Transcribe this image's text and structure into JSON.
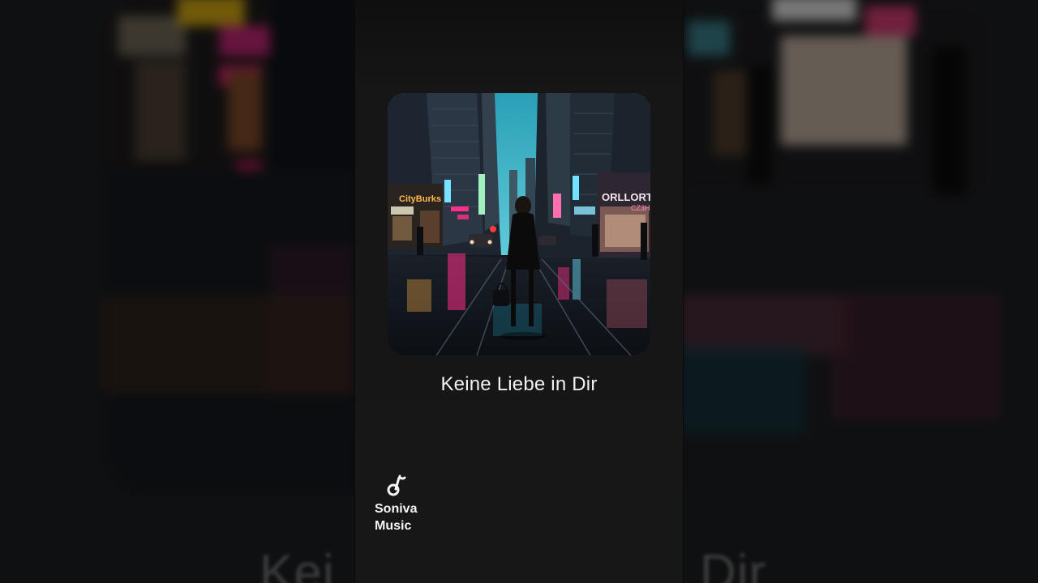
{
  "video": {
    "song_title": "Keine Liebe in Dir",
    "channel": {
      "name_line1": "Soniva",
      "name_line2": "Music",
      "icon": "music-note-icon"
    },
    "background_text_left": "Kei",
    "background_text_right": "Dir"
  },
  "artwork": {
    "signs": [
      "CityBurks",
      "ORLLORT",
      "CZ3H"
    ],
    "colors": {
      "sky": "#3fb6c8",
      "neon_pink": "#ff2e8a",
      "neon_orange": "#ffb14a",
      "neon_cyan": "#6fe3ff"
    }
  }
}
